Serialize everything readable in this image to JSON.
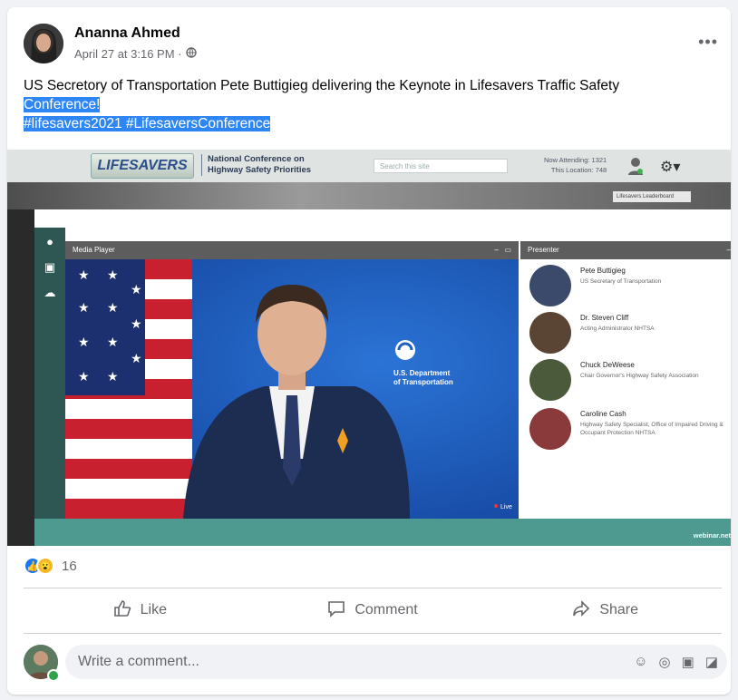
{
  "post": {
    "author": "Ananna Ahmed",
    "time": "April 27 at 3:16 PM · ",
    "text_line1": "US Secretory of Transportation Pete Buttigieg delivering the Keynote in Lifesavers Traffic Safety",
    "text_line2": "Conference!",
    "hashtags": "#lifesavers2021 #LifesaversConference"
  },
  "screenshot": {
    "logo_text": "LIFESAVERS",
    "conference_line1": "National Conference on",
    "conference_line2": "Highway Safety Priorities",
    "search_placeholder": "Search this site",
    "attending_label": "Now Attending: 1321",
    "location_label": "This Location: 748",
    "leaderboard": "Lifesavers Leaderboard",
    "media_player_title": "Media Player",
    "presenter_title": "Presenter",
    "dot_label_line1": "U.S. Department",
    "dot_label_line2": "of Transportation",
    "live_label": "Live",
    "footer_brand": "webinar.net",
    "presenters": [
      {
        "name": "Pete Buttigieg",
        "role": "US Secretary of Transportation"
      },
      {
        "name": "Dr. Steven Cliff",
        "role": "Acting Administrator NHTSA"
      },
      {
        "name": "Chuck DeWeese",
        "role": "Chair Governor's Highway Safety Association"
      },
      {
        "name": "Caroline Cash",
        "role": "Highway Safety Specialist, Office of Impaired Driving & Occupant Protection NHTSA"
      }
    ]
  },
  "reactions": {
    "count": "16"
  },
  "actions": {
    "like": "Like",
    "comment": "Comment",
    "share": "Share"
  },
  "comment": {
    "placeholder": "Write a comment..."
  },
  "colors": {
    "selection": "#2d86f4",
    "teal": "#2e5753",
    "video_blue": "#1f5fbd"
  }
}
